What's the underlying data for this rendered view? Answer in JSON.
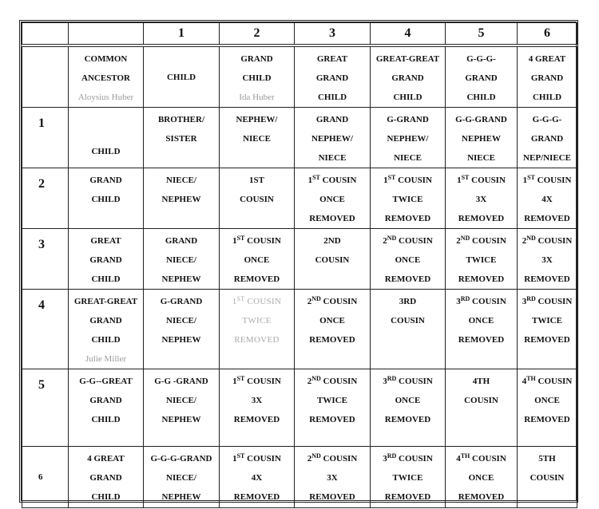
{
  "header": {
    "columns": [
      "",
      "",
      "1",
      "2",
      "3",
      "4",
      "5",
      "6"
    ]
  },
  "rows": [
    {
      "label": "",
      "cells": [
        [
          {
            "text": "COMMON"
          },
          {
            "text": "ANCESTOR"
          },
          {
            "text": "Aloysius Huber",
            "style": "faded"
          }
        ],
        [
          {
            "text": "CHILD"
          }
        ],
        [
          {
            "text": "GRAND"
          },
          {
            "text": "CHILD"
          },
          {
            "text": "Ida Huber",
            "style": "faded"
          }
        ],
        [
          {
            "text": "GREAT"
          },
          {
            "text": "GRAND"
          },
          {
            "text": "CHILD"
          }
        ],
        [
          {
            "text": "GREAT-GREAT"
          },
          {
            "text": "GRAND"
          },
          {
            "text": "CHILD"
          }
        ],
        [
          {
            "text": "G-G-G-"
          },
          {
            "text": "GRAND"
          },
          {
            "text": "CHILD"
          }
        ],
        [
          {
            "text": "4 GREAT"
          },
          {
            "text": "GRAND"
          },
          {
            "text": "CHILD"
          }
        ]
      ]
    },
    {
      "label": "1",
      "cells": [
        [
          {
            "text": "CHILD"
          }
        ],
        [
          {
            "text": "BROTHER/"
          },
          {
            "text": "SISTER"
          }
        ],
        [
          {
            "text": "NEPHEW/"
          },
          {
            "text": "NIECE"
          }
        ],
        [
          {
            "text": "GRAND"
          },
          {
            "text": "NEPHEW/"
          },
          {
            "text": "NIECE"
          }
        ],
        [
          {
            "text": "G-GRAND"
          },
          {
            "text": "NEPHEW/"
          },
          {
            "text": "NIECE"
          }
        ],
        [
          {
            "text": "G-G-GRAND"
          },
          {
            "text": "NEPHEW"
          },
          {
            "text": "NIECE"
          }
        ],
        [
          {
            "text": "G-G-G-"
          },
          {
            "text": "GRAND"
          },
          {
            "text": "NEP/NIECE"
          }
        ]
      ]
    },
    {
      "label": "2",
      "cells": [
        [
          {
            "text": "GRAND"
          },
          {
            "text": "CHILD"
          }
        ],
        [
          {
            "text": "NIECE/"
          },
          {
            "text": "NEPHEW"
          }
        ],
        [
          {
            "text": "1ST"
          },
          {
            "text": "COUSIN"
          }
        ],
        [
          {
            "text": "1ST COUSIN"
          },
          {
            "text": "ONCE"
          },
          {
            "text": "REMOVED"
          }
        ],
        [
          {
            "text": "1ST COUSIN"
          },
          {
            "text": "TWICE"
          },
          {
            "text": "REMOVED"
          }
        ],
        [
          {
            "text": "1ST COUSIN"
          },
          {
            "text": "3X"
          },
          {
            "text": "REMOVED"
          }
        ],
        [
          {
            "text": "1ST COUSIN"
          },
          {
            "text": "4X"
          },
          {
            "text": "REMOVED"
          }
        ]
      ]
    },
    {
      "label": "3",
      "cells": [
        [
          {
            "text": "GREAT"
          },
          {
            "text": "GRAND"
          },
          {
            "text": "CHILD"
          }
        ],
        [
          {
            "text": "GRAND"
          },
          {
            "text": "NIECE/"
          },
          {
            "text": "NEPHEW"
          }
        ],
        [
          {
            "text": "1ST COUSIN"
          },
          {
            "text": "ONCE"
          },
          {
            "text": "REMOVED"
          }
        ],
        [
          {
            "text": "2ND"
          },
          {
            "text": "COUSIN"
          }
        ],
        [
          {
            "text": "2ND COUSIN"
          },
          {
            "text": "ONCE"
          },
          {
            "text": "REMOVED"
          }
        ],
        [
          {
            "text": "2ND COUSIN"
          },
          {
            "text": "TWICE"
          },
          {
            "text": "REMOVED"
          }
        ],
        [
          {
            "text": "2ND COUSIN"
          },
          {
            "text": "3X"
          },
          {
            "text": "REMOVED"
          }
        ]
      ]
    },
    {
      "label": "4",
      "cells": [
        [
          {
            "text": "GREAT-GREAT"
          },
          {
            "text": "GRAND"
          },
          {
            "text": "CHILD"
          },
          {
            "text": "Julie Miller",
            "style": "faded"
          }
        ],
        [
          {
            "text": "G-GRAND"
          },
          {
            "text": "NIECE/"
          },
          {
            "text": "NEPHEW"
          }
        ],
        [
          {
            "text": "1ST COUSIN",
            "style": "ghost"
          },
          {
            "text": "TWICE",
            "style": "ghost"
          },
          {
            "text": "REMOVED",
            "style": "ghost"
          }
        ],
        [
          {
            "text": "2ND COUSIN"
          },
          {
            "text": "ONCE"
          },
          {
            "text": "REMOVED"
          }
        ],
        [
          {
            "text": "3RD"
          },
          {
            "text": "COUSIN"
          }
        ],
        [
          {
            "text": "3RD COUSIN"
          },
          {
            "text": "ONCE"
          },
          {
            "text": "REMOVED"
          }
        ],
        [
          {
            "text": "3RD COUSIN"
          },
          {
            "text": "TWICE"
          },
          {
            "text": "REMOVED"
          }
        ]
      ]
    },
    {
      "label": "5",
      "cells": [
        [
          {
            "text": "G-G--GREAT"
          },
          {
            "text": "GRAND"
          },
          {
            "text": "CHILD"
          }
        ],
        [
          {
            "text": "G-G -GRAND"
          },
          {
            "text": "NIECE/"
          },
          {
            "text": "NEPHEW"
          }
        ],
        [
          {
            "text": "1ST COUSIN"
          },
          {
            "text": "3X"
          },
          {
            "text": "REMOVED"
          }
        ],
        [
          {
            "text": "2ND COUSIN"
          },
          {
            "text": "TWICE"
          },
          {
            "text": "REMOVED"
          }
        ],
        [
          {
            "text": "3RD COUSIN"
          },
          {
            "text": "ONCE"
          },
          {
            "text": "REMOVED"
          }
        ],
        [
          {
            "text": "4TH"
          },
          {
            "text": "COUSIN"
          }
        ],
        [
          {
            "text": "4TH COUSIN"
          },
          {
            "text": "ONCE"
          },
          {
            "text": "REMOVED"
          }
        ]
      ]
    },
    {
      "label": "6",
      "cells": [
        [
          {
            "text": "4 GREAT"
          },
          {
            "text": "GRAND"
          },
          {
            "text": "CHILD"
          }
        ],
        [
          {
            "text": "G-G-G-GRAND"
          },
          {
            "text": "NIECE/"
          },
          {
            "text": "NEPHEW"
          }
        ],
        [
          {
            "text": "1ST COUSIN"
          },
          {
            "text": "4X"
          },
          {
            "text": "REMOVED"
          }
        ],
        [
          {
            "text": "2ND COUSIN"
          },
          {
            "text": "3X"
          },
          {
            "text": "REMOVED"
          }
        ],
        [
          {
            "text": "3RD COUSIN"
          },
          {
            "text": "TWICE"
          },
          {
            "text": "REMOVED"
          }
        ],
        [
          {
            "text": "4TH COUSIN"
          },
          {
            "text": "ONCE"
          },
          {
            "text": "REMOVED"
          }
        ],
        [
          {
            "text": "5TH"
          },
          {
            "text": "COUSIN"
          }
        ]
      ]
    }
  ]
}
